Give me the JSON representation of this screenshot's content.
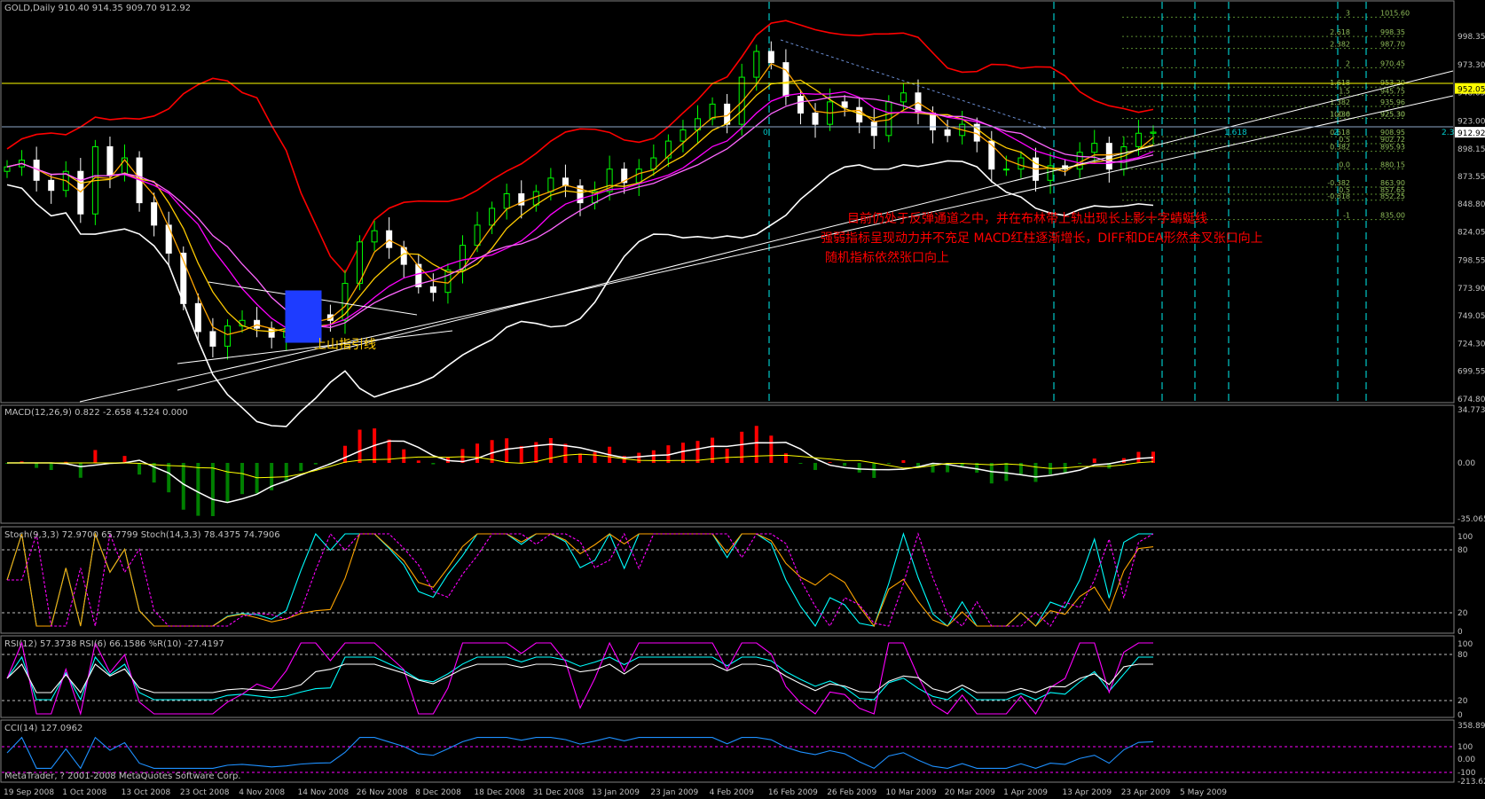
{
  "panels": {
    "price_header": "GOLD,Daily  910.40 914.35 909.70 912.92",
    "macd_header": "MACD(12,26,9) 0.822 -2.658 4.524 0.000",
    "stoch_header": "Stoch(9,3,3) 72.9700 65.7799  Stoch(14,3,3) 78.4375 74.7906",
    "rsi_header": "RSI(12) 57.3738  RSI(6) 66.1586  %R(10) -27.4197",
    "cci_header": "CCI(14) 127.0962",
    "copyright": "MetaTrader, ? 2001-2008 MetaQuotes Software Corp."
  },
  "annotations": {
    "line1": "目前仍处于反弹通道之中，并在布林带上轨出现长上影十字蜻蜓线",
    "line2": "强弱指标呈现动力并不充足 MACD红柱逐渐增长，DIFF和DEA形然金叉张口向上",
    "line3": "随机指标依然张口向上",
    "uphill_label": "上山指引线"
  },
  "price_axis": [
    "998.35",
    "973.30",
    "948.05",
    "923.00",
    "898.15",
    "873.55",
    "848.80",
    "824.05",
    "798.55",
    "773.90",
    "749.05",
    "724.30",
    "699.55",
    "674.80"
  ],
  "price_marks": {
    "yellow_level": "952.05",
    "current": "912.92"
  },
  "macd_axis": [
    "34.7739",
    "0.00",
    "-35.065"
  ],
  "stoch_axis": [
    "100",
    "80",
    "20",
    "0"
  ],
  "rsi_axis": [
    "100",
    "80",
    "20",
    "0"
  ],
  "cci_axis": [
    "358.892",
    "100",
    "0.00",
    "-100",
    "-213.621"
  ],
  "fib_labels": [
    "3",
    "2.618",
    "2.382",
    "2",
    "1.618",
    "1.5",
    "1.382",
    "1.236",
    "100.0",
    "0.618",
    "0.5",
    "0.382",
    "0.0",
    "-0.382",
    "-0.5",
    "-0.618",
    "-1"
  ],
  "fib_values": [
    "1015.60",
    "998.35",
    "987.70",
    "970.45",
    "953.20",
    "945.75",
    "935.96",
    "925.30",
    "925.30",
    "908.95",
    "902.72",
    "895.93",
    "880.15",
    "863.90",
    "857.65",
    "852.25",
    "835.00"
  ],
  "cycle_labels": [
    "0",
    "1.618",
    "2",
    "2.382"
  ],
  "dates": [
    "19 Sep 2008",
    "1 Oct 2008",
    "13 Oct 2008",
    "23 Oct 2008",
    "4 Nov 2008",
    "14 Nov 2008",
    "26 Nov 2008",
    "8 Dec 2008",
    "18 Dec 2008",
    "31 Dec 2008",
    "13 Jan 2009",
    "23 Jan 2009",
    "4 Feb 2009",
    "16 Feb 2009",
    "26 Feb 2009",
    "10 Mar 2009",
    "20 Mar 2009",
    "1 Apr 2009",
    "13 Apr 2009",
    "23 Apr 2009",
    "5 May 2009"
  ],
  "colors": {
    "bull": "#00ff00",
    "bear": "#ffffff",
    "macd_pos": "#ff0000",
    "macd_neg": "#008000",
    "yellow": "#ffff00",
    "annot": "#ff0000"
  },
  "chart_data": [
    {
      "type": "candlestick",
      "title": "GOLD,Daily",
      "symbol": "GOLD",
      "timeframe": "Daily",
      "last_bar": {
        "open": 910.4,
        "high": 914.35,
        "low": 909.7,
        "close": 912.92
      },
      "y_range": [
        674.8,
        1023
      ],
      "horizontal_levels": [
        952.05,
        912.92
      ],
      "x_range": [
        "19 Sep 2008",
        "5 May 2009"
      ],
      "series": [
        {
          "type": "close",
          "values": [
            882,
            888,
            870,
            861,
            878,
            840,
            900,
            875,
            890,
            850,
            830,
            805,
            760,
            735,
            722,
            740,
            745,
            738,
            730,
            736,
            745,
            750,
            745,
            778,
            815,
            825,
            810,
            795,
            775,
            770,
            790,
            812,
            830,
            845,
            858,
            848,
            860,
            872,
            865,
            850,
            860,
            880,
            868,
            880,
            890,
            905,
            915,
            925,
            938,
            920,
            962,
            985,
            975,
            945,
            930,
            920,
            940,
            935,
            922,
            910,
            940,
            948,
            930,
            915,
            910,
            920,
            905,
            880,
            880,
            890,
            870,
            883,
            880,
            895,
            903,
            880,
            900,
            912,
            913
          ]
        }
      ]
    },
    {
      "type": "line",
      "title": "MACD(12,26,9)",
      "values": {
        "macd": 0.822,
        "signal": -2.658,
        "osma": 4.524
      },
      "y_range": [
        -35.065,
        34.7739
      ]
    },
    {
      "type": "line",
      "title": "Stoch(9,3,3) / Stoch(14,3,3)",
      "values": {
        "stoch9_main": 72.97,
        "stoch9_signal": 65.7799,
        "stoch14_main": 78.4375,
        "stoch14_signal": 74.7906
      },
      "levels": [
        20,
        80
      ],
      "y_range": [
        0,
        100
      ]
    },
    {
      "type": "line",
      "title": "RSI(12) RSI(6) %R(10)",
      "values": {
        "rsi12": 57.3738,
        "rsi6": 66.1586,
        "wpr10": -27.4197
      },
      "levels": [
        20,
        80
      ],
      "y_range": [
        0,
        100
      ]
    },
    {
      "type": "line",
      "title": "CCI(14)",
      "values": {
        "cci14": 127.0962
      },
      "levels": [
        -100,
        100
      ],
      "y_range": [
        -213.621,
        358.892
      ]
    }
  ]
}
